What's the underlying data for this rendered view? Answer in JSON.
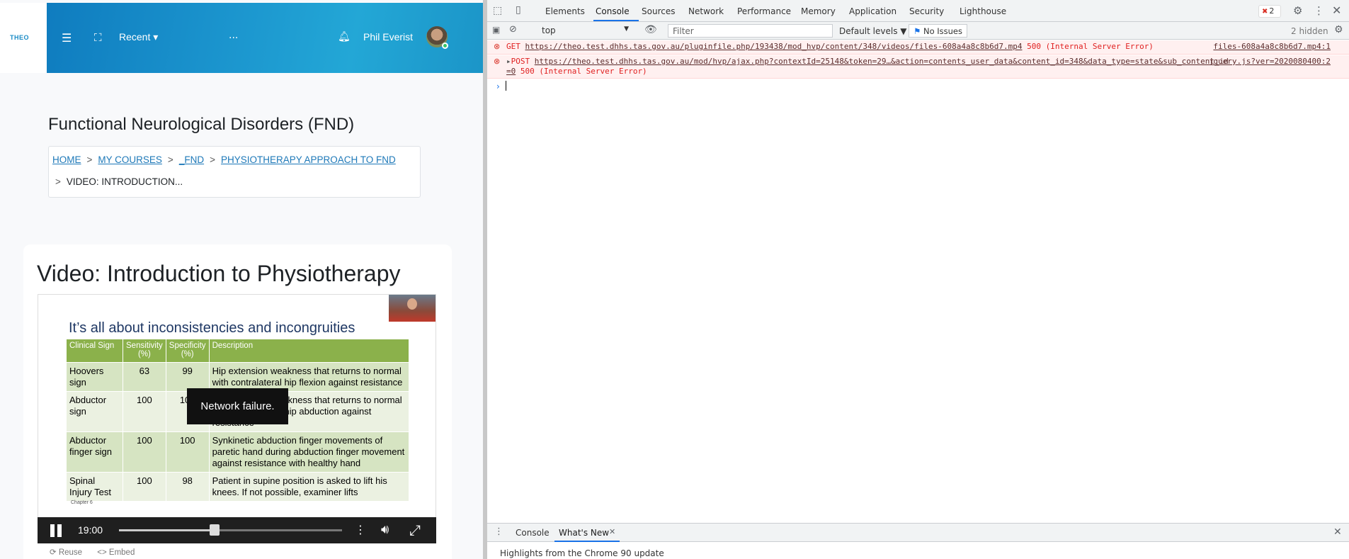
{
  "site": {
    "logo_text": "THEO",
    "nav": {
      "recent_label": "Recent ▾",
      "more_label": "···",
      "user_name": "Phil Everist"
    },
    "course_title": "Functional Neurological Disorders (FND)",
    "breadcrumb": {
      "items": [
        "HOME",
        "MY COURSES",
        "_FND",
        "PHYSIOTHERAPY APPROACH TO FND"
      ],
      "current": "VIDEO: INTRODUCTION...",
      "separator": ">"
    },
    "video_title": "Video: Introduction to Physiotherapy",
    "slide": {
      "title": "It’s all about inconsistencies and incongruities",
      "headers": [
        "Clinical Sign",
        "Sensitivity (%)",
        "Specificity (%)",
        "Description"
      ],
      "rows": [
        [
          "Hoovers sign",
          "63",
          "99",
          "Hip extension weakness that returns to normal with contralateral hip flexion against resistance"
        ],
        [
          "Abductor sign",
          "100",
          "100",
          "Hip abduction weakness that returns to normal with contralateral hip abduction against resistance"
        ],
        [
          "Abductor finger sign",
          "100",
          "100",
          "Synkinetic abduction finger movements of paretic hand during abduction finger movement against resistance with healthy hand"
        ],
        [
          "Spinal Injury Test",
          "100",
          "98",
          "Patient in supine position is asked to lift his knees. If not possible, examiner lifts"
        ]
      ],
      "caption": "Chapter 6"
    },
    "player": {
      "error_message": "Network failure.",
      "time": "19:00",
      "progress": 0.43,
      "reuse_label": "⟳ Reuse",
      "embed_label": "<> Embed"
    }
  },
  "devtools": {
    "tabs": [
      "Elements",
      "Console",
      "Sources",
      "Network",
      "Performance",
      "Memory",
      "Application",
      "Security",
      "Lighthouse"
    ],
    "active_tab": "Console",
    "error_count": "2",
    "toolbar": {
      "context": "top",
      "filter_placeholder": "Filter",
      "levels": "Default levels ▼",
      "issues": "No Issues",
      "hidden": "2 hidden"
    },
    "messages": [
      {
        "method": "GET",
        "url": "https://theo.test.dhhs.tas.gov.au/pluginfile.php/193438/mod_hvp/content/348/videos/files-608a4a8c8b6d7.mp4",
        "status": "500 (Internal Server Error)",
        "source": "files-608a4a8c8b6d7.mp4:1"
      },
      {
        "method": "POST",
        "url": "https://theo.test.dhhs.tas.gov.au/mod/hvp/ajax.php?contextId=25148&token=29…&action=contents_user_data&content_id=348&data_type=state&sub_content_id=0",
        "status": "500 (Internal Server Error)",
        "source": "jquery.js?ver=2020080400:2"
      }
    ],
    "drawer": {
      "tabs": [
        "Console",
        "What's New"
      ],
      "active_tab": "What's New",
      "content": "Highlights from the Chrome 90 update"
    }
  }
}
